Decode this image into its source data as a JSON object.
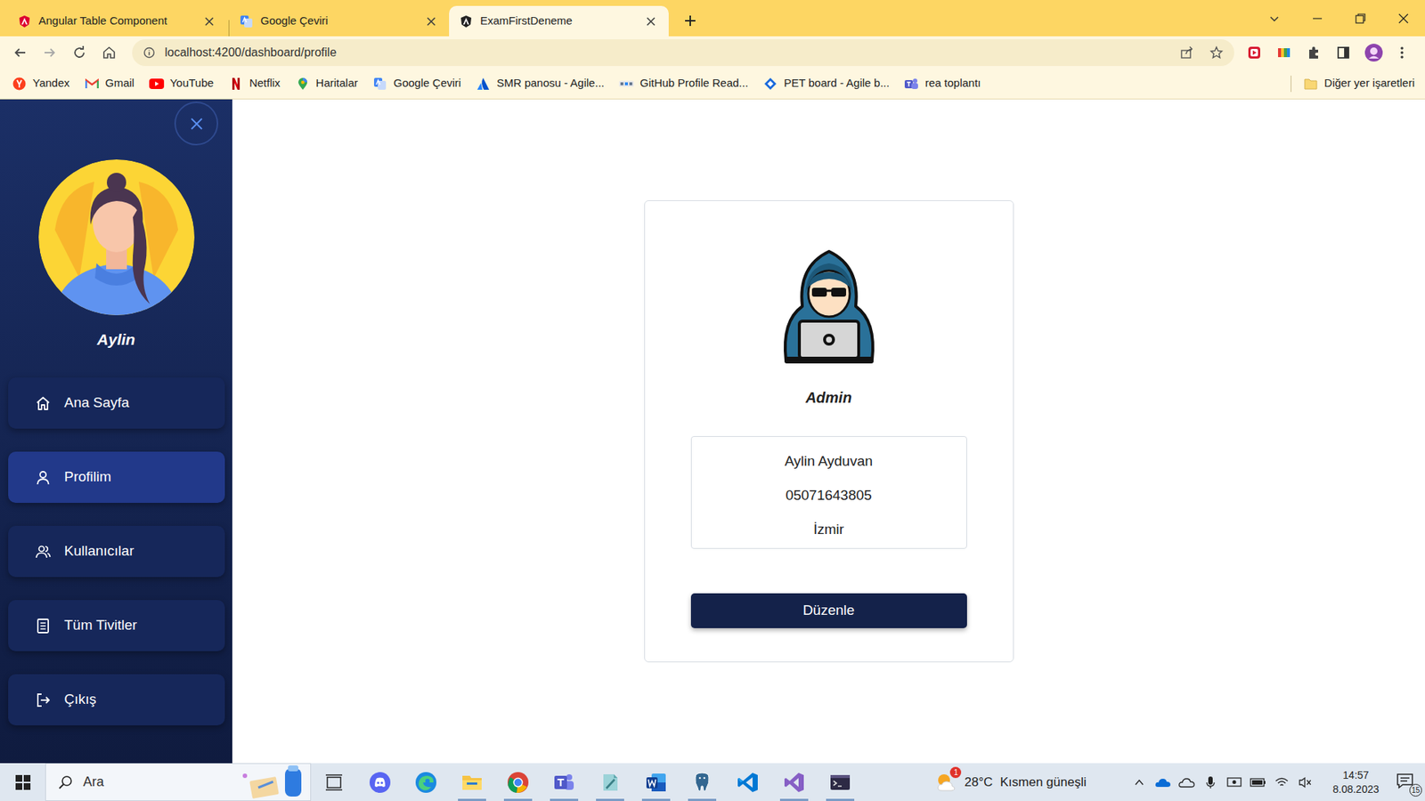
{
  "browser": {
    "tabs": [
      {
        "label": "Angular Table Component",
        "selected": false
      },
      {
        "label": "Google Çeviri",
        "selected": false
      },
      {
        "label": "ExamFirstDeneme",
        "selected": true
      }
    ],
    "address": "localhost:4200/dashboard/profile",
    "bookmarks": [
      "Yandex",
      "Gmail",
      "YouTube",
      "Netflix",
      "Haritalar",
      "Google Çeviri",
      "SMR panosu - Agile...",
      "GitHub Profile Read...",
      "PET board - Agile b...",
      "rea toplantı"
    ],
    "other_bookmarks": "Diğer yer işaretleri"
  },
  "sidebar": {
    "user_name": "Aylin",
    "items": [
      {
        "label": "Ana Sayfa",
        "selected": false
      },
      {
        "label": "Profilim",
        "selected": true
      },
      {
        "label": "Kullanıcılar",
        "selected": false
      },
      {
        "label": "Tüm Tivitler",
        "selected": false
      },
      {
        "label": "Çıkış",
        "selected": false
      }
    ]
  },
  "profile": {
    "role": "Admin",
    "details": [
      "Aylin Ayduvan",
      "05071643805",
      "İzmir"
    ],
    "button": "Düzenle"
  },
  "taskbar": {
    "search_placeholder": "Ara",
    "apps": [
      {
        "running": false
      },
      {
        "running": false
      },
      {
        "running": true
      },
      {
        "running": true
      },
      {
        "running": true
      },
      {
        "running": true
      },
      {
        "running": true
      },
      {
        "running": true
      },
      {
        "running": false
      },
      {
        "running": true
      },
      {
        "running": true
      }
    ],
    "weather": {
      "badge": "1",
      "temperature": "28°C",
      "condition": "Kısmen güneşli"
    },
    "time": "14:57",
    "date": "8.08.2023",
    "notifications": "15"
  }
}
